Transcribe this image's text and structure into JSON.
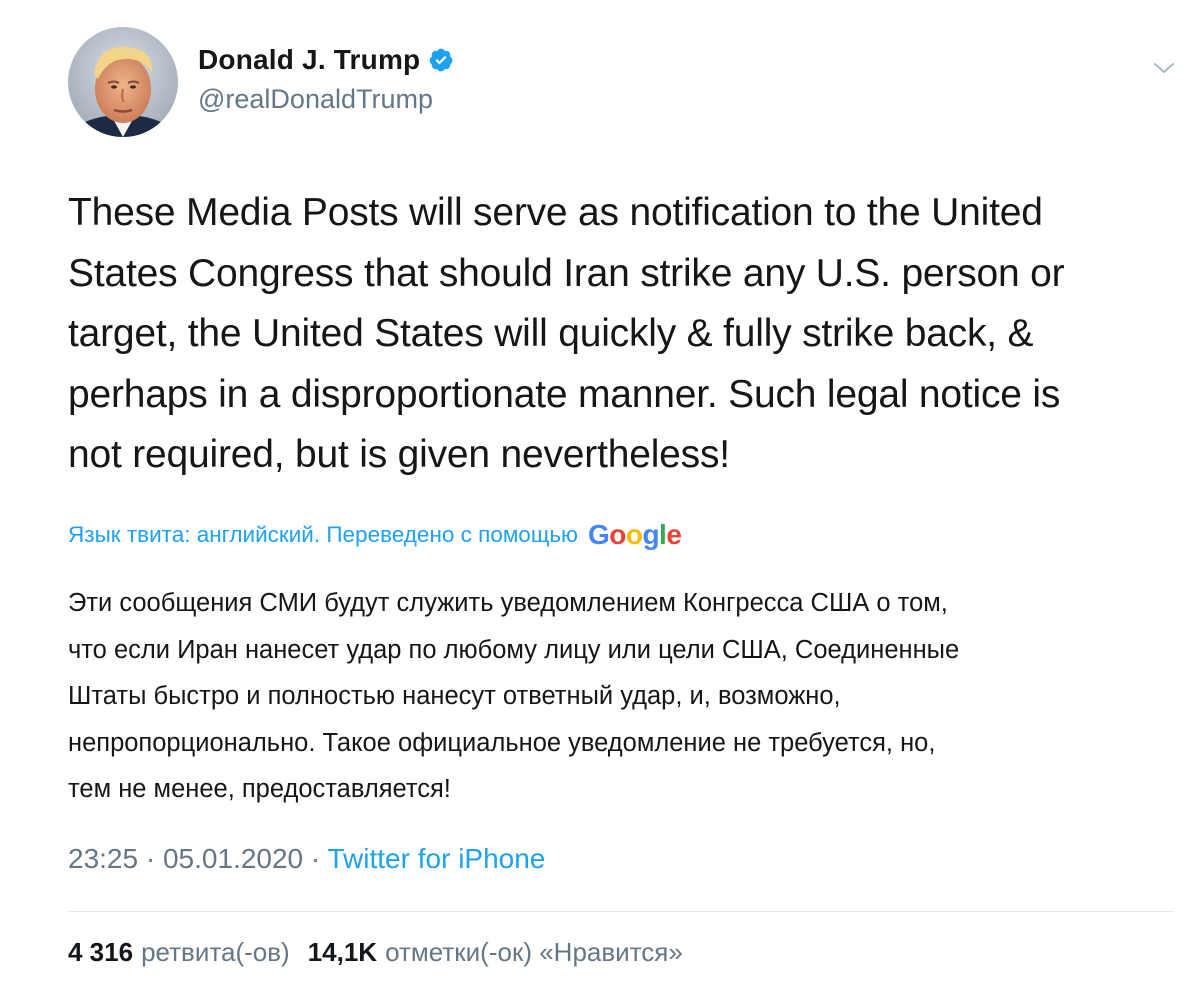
{
  "author": {
    "display_name": "Donald J. Trump",
    "handle": "@realDonaldTrump",
    "verified": true
  },
  "tweet": {
    "text_lines": [
      "These Media Posts will serve as notification to the United",
      "States Congress that should Iran strike any U.S. person or",
      "target, the United States will quickly & fully strike back, &",
      "perhaps in a disproportionate manner. Such legal notice is",
      "not required, but is given nevertheless!"
    ]
  },
  "translation": {
    "label": "Язык твита: английский. Переведено с помощью",
    "provider_letters": [
      "G",
      "o",
      "o",
      "g",
      "l",
      "e"
    ],
    "text_lines": [
      "Эти сообщения СМИ будут служить уведомлением Конгресса США о том,",
      "что если Иран нанесет удар по любому лицу или цели США, Соединенные",
      "Штаты быстро и полностью нанесут ответный удар, и, возможно,",
      "непропорционально. Такое официальное уведомление не требуется, но,",
      "тем не менее, предоставляется!"
    ]
  },
  "meta": {
    "time": "23:25",
    "separator": "·",
    "date": "05.01.2020",
    "source": "Twitter for iPhone"
  },
  "stats": {
    "retweets_count": "4 316",
    "retweets_label": "ретвита(-ов)",
    "likes_count": "14,1K",
    "likes_label": "отметки(-ок) «Нравится»"
  },
  "colors": {
    "accent": "#1da1f2",
    "secondary_text": "#657786",
    "primary_text": "#14171a",
    "divider": "#e1e8ed"
  },
  "icons": {
    "verified": "verified-badge-icon",
    "menu": "chevron-down-icon"
  }
}
